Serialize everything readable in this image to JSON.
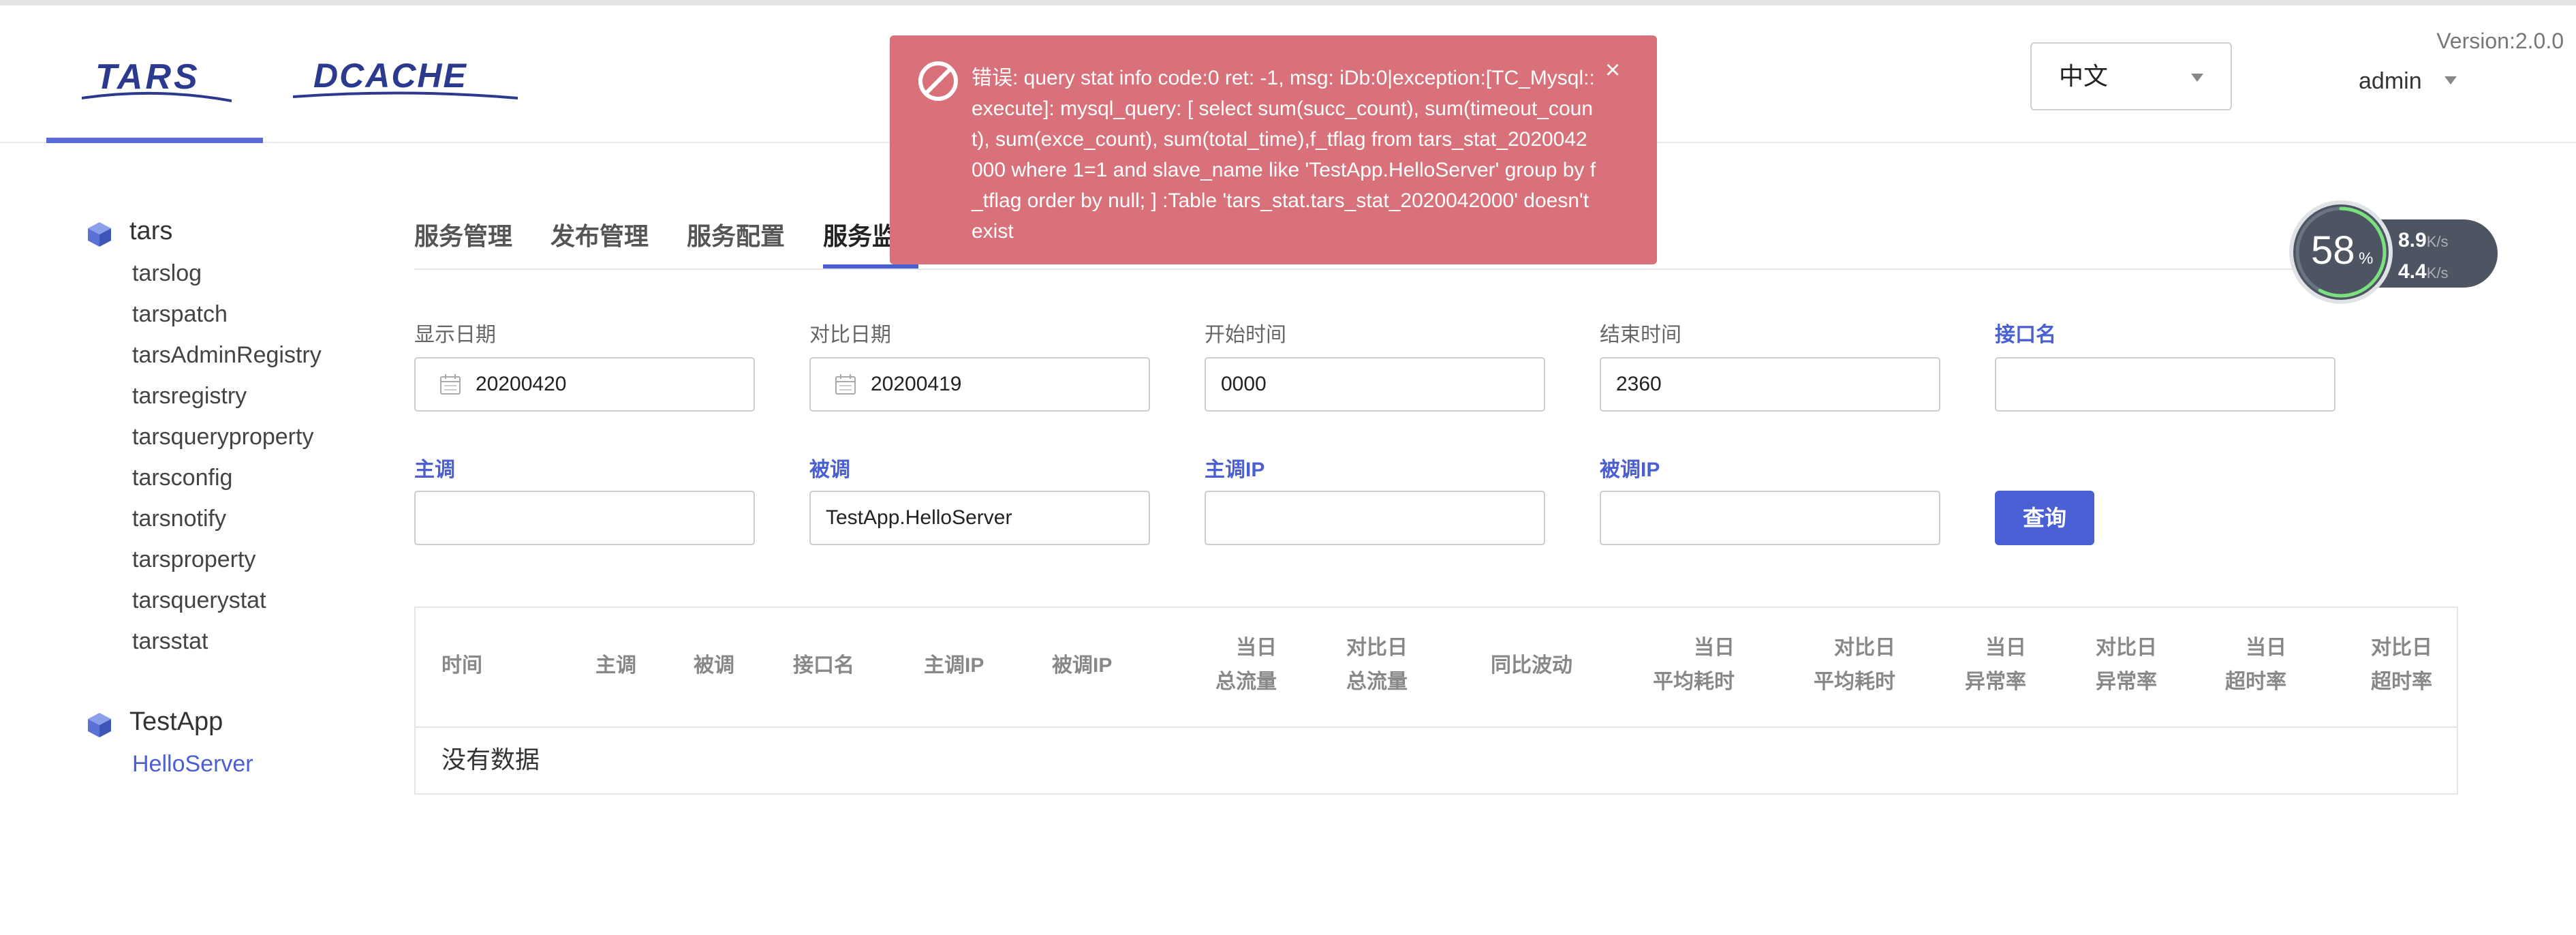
{
  "header": {
    "version": "Version:2.0.0",
    "language_selected": "中文",
    "user": "admin",
    "logos": [
      "TARS",
      "DCACHE"
    ]
  },
  "toast": {
    "message": "错误: query stat info code:0 ret: -1, msg: iDb:0|exception:[TC_Mysql::execute]: mysql_query: [ select sum(succ_count), sum(timeout_count), sum(exce_count), sum(total_time),f_tflag from tars_stat_2020042000 where 1=1 and slave_name like 'TestApp.HelloServer' group by f_tflag order by null; ] :Table 'tars_stat.tars_stat_2020042000' doesn't exist",
    "close_symbol": "×",
    "background": "#d9717a"
  },
  "sidebar": {
    "groups": [
      {
        "label": "tars",
        "children": [
          "tarslog",
          "tarspatch",
          "tarsAdminRegistry",
          "tarsregistry",
          "tarsqueryproperty",
          "tarsconfig",
          "tarsnotify",
          "tarsproperty",
          "tarsquerystat",
          "tarsstat"
        ]
      },
      {
        "label": "TestApp",
        "children": [
          "HelloServer"
        ]
      }
    ]
  },
  "tabs": [
    "服务管理",
    "发布管理",
    "服务配置",
    "服务监"
  ],
  "form": {
    "show_date": {
      "label": "显示日期",
      "value": "20200420"
    },
    "compare_date": {
      "label": "对比日期",
      "value": "20200419"
    },
    "start_time": {
      "label": "开始时间",
      "value": "0000"
    },
    "end_time": {
      "label": "结束时间",
      "value": "2360"
    },
    "interface": {
      "label": "接口名",
      "value": ""
    },
    "caller": {
      "label": "主调",
      "value": ""
    },
    "callee": {
      "label": "被调",
      "value": "TestApp.HelloServer"
    },
    "caller_ip": {
      "label": "主调IP",
      "value": ""
    },
    "callee_ip": {
      "label": "被调IP",
      "value": ""
    },
    "query_button": "查询"
  },
  "table": {
    "columns": {
      "time": "时间",
      "caller": "主调",
      "callee": "被调",
      "interface": "接口名",
      "caller_ip": "主调IP",
      "callee_ip": "被调IP",
      "today_total_l1": "当日",
      "today_total_l2": "总流量",
      "cmp_total_l1": "对比日",
      "cmp_total_l2": "总流量",
      "yoy": "同比波动",
      "today_avg_l1": "当日",
      "today_avg_l2": "平均耗时",
      "cmp_avg_l1": "对比日",
      "cmp_avg_l2": "平均耗时",
      "today_err_l1": "当日",
      "today_err_l2": "异常率",
      "cmp_err_l1": "对比日",
      "cmp_err_l2": "异常率",
      "today_to_l1": "当日",
      "today_to_l2": "超时率",
      "cmp_to_l1": "对比日",
      "cmp_to_l2": "超时率"
    },
    "empty_text": "没有数据"
  },
  "speed_widget": {
    "percent": "58",
    "percent_sign": "%",
    "upload": "8.9",
    "download": "4.4",
    "unit": "K/s"
  },
  "colors": {
    "accent": "#4a5fd4",
    "error": "#d9717a"
  }
}
